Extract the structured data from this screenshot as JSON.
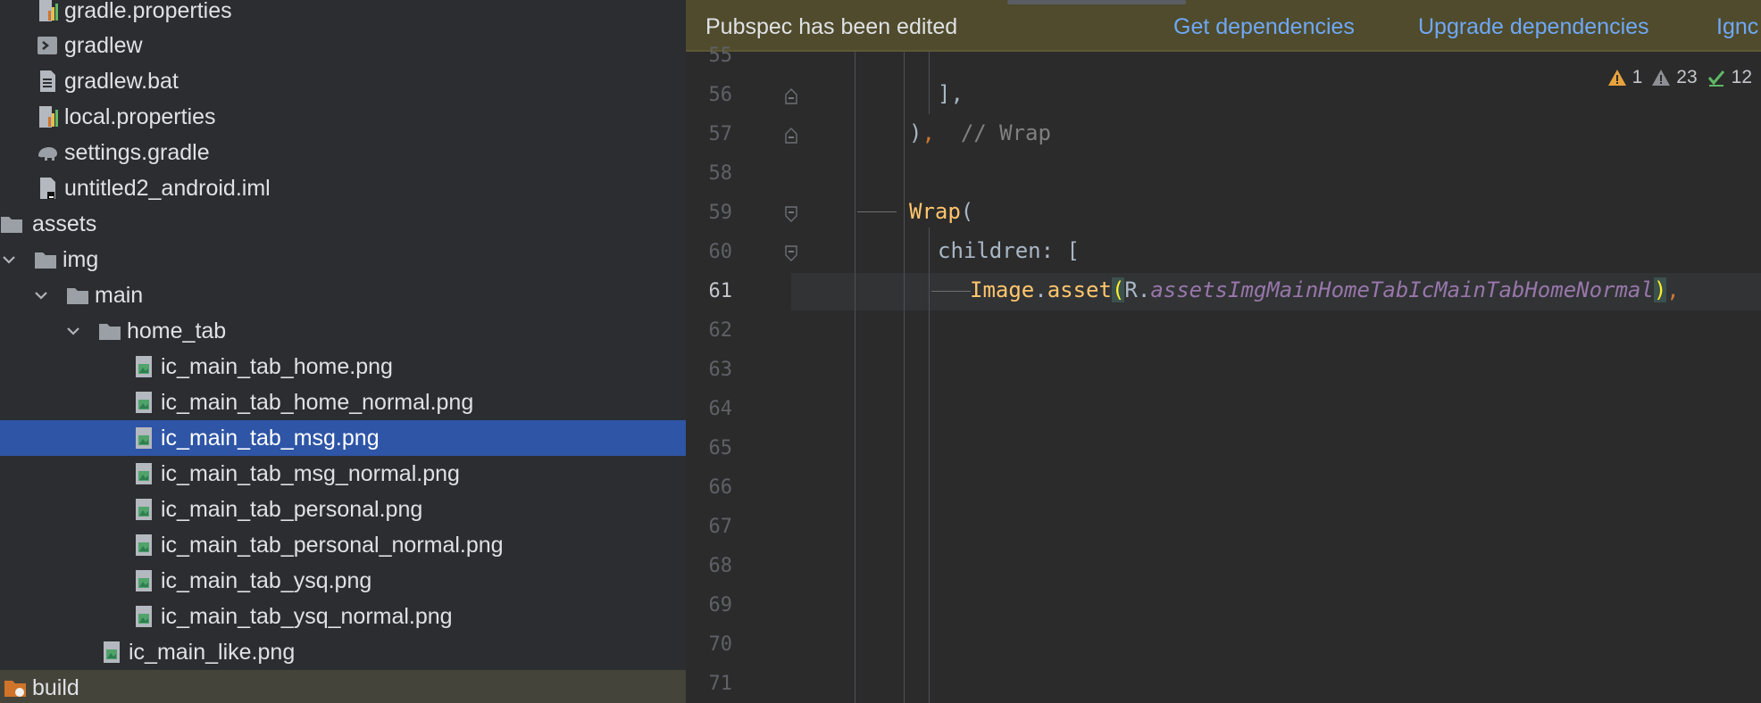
{
  "project_tree": {
    "items": [
      {
        "label": "gradle.properties",
        "icon": "properties-file-icon",
        "chevron": ""
      },
      {
        "label": "gradlew",
        "icon": "shell-script-icon",
        "chevron": ""
      },
      {
        "label": "gradlew.bat",
        "icon": "text-file-icon",
        "chevron": ""
      },
      {
        "label": "local.properties",
        "icon": "properties-file-icon",
        "chevron": ""
      },
      {
        "label": "settings.gradle",
        "icon": "gradle-elephant-icon",
        "chevron": ""
      },
      {
        "label": "untitled2_android.iml",
        "icon": "module-file-icon",
        "chevron": ""
      },
      {
        "label": "assets",
        "icon": "folder-icon",
        "chevron": ""
      },
      {
        "label": "img",
        "icon": "folder-icon",
        "chevron": "expanded"
      },
      {
        "label": "main",
        "icon": "folder-icon",
        "chevron": "expanded"
      },
      {
        "label": "home_tab",
        "icon": "folder-icon",
        "chevron": "expanded"
      },
      {
        "label": "ic_main_tab_home.png",
        "icon": "image-file-icon",
        "chevron": ""
      },
      {
        "label": "ic_main_tab_home_normal.png",
        "icon": "image-file-icon",
        "chevron": ""
      },
      {
        "label": "ic_main_tab_msg.png",
        "icon": "image-file-icon",
        "chevron": "",
        "selected": true
      },
      {
        "label": "ic_main_tab_msg_normal.png",
        "icon": "image-file-icon",
        "chevron": ""
      },
      {
        "label": "ic_main_tab_personal.png",
        "icon": "image-file-icon",
        "chevron": ""
      },
      {
        "label": "ic_main_tab_personal_normal.png",
        "icon": "image-file-icon",
        "chevron": ""
      },
      {
        "label": "ic_main_tab_ysq.png",
        "icon": "image-file-icon",
        "chevron": ""
      },
      {
        "label": "ic_main_tab_ysq_normal.png",
        "icon": "image-file-icon",
        "chevron": ""
      },
      {
        "label": "ic_main_like.png",
        "icon": "image-file-icon",
        "chevron": ""
      },
      {
        "label": "build",
        "icon": "build-folder-icon",
        "chevron": ""
      }
    ]
  },
  "notification": {
    "text": "Pubspec has been edited",
    "actions": [
      "Get dependencies",
      "Upgrade dependencies",
      "Ignc"
    ]
  },
  "inspections": {
    "errors": "1",
    "warnings": "23",
    "weak": "12"
  },
  "editor": {
    "current_line": "61",
    "line_numbers": [
      "55",
      "56",
      "57",
      "58",
      "59",
      "60",
      "61",
      "62",
      "63",
      "64",
      "65",
      "66",
      "67",
      "68",
      "69",
      "70",
      "71"
    ],
    "code": {
      "l56_bracket": "],",
      "l57_paren": ")",
      "l57_comma": ",",
      "l57_comment": "// Wrap",
      "l59_wrap": "Wrap",
      "l59_paren": "(",
      "l60_children": "children: [",
      "l61_image": "Image",
      "l61_dot": ".",
      "l61_asset": "asset",
      "l61_open": "(",
      "l61_r": "R.",
      "l61_field": "assetsImgMainHomeTabIcMainTabHomeNormal",
      "l61_close": ")",
      "l61_comma": ","
    }
  },
  "colors": {
    "selection": "#2e55a6",
    "notification_bg": "#4f4b2c",
    "link": "#6fa8f5",
    "keyword_orange": "#cc7832",
    "function_yellow": "#ffc66d",
    "field_purple": "#9876aa"
  }
}
